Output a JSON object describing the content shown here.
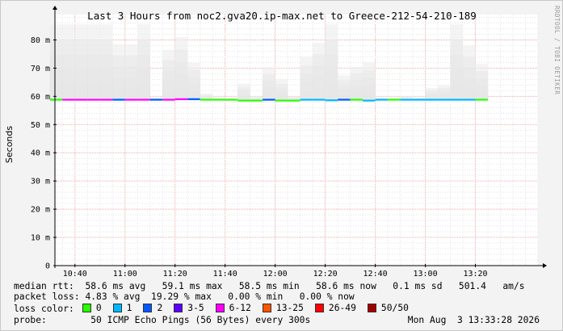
{
  "chart_data": {
    "type": "line",
    "title": "Last 3 Hours from noc2.gva20.ip-max.net to Greece-212-54-210-189",
    "ylabel": "Seconds",
    "watermark": "RRDTOOL / TOBI OETIKER",
    "ylim": [
      0,
      0.089
    ],
    "y_ticks": [
      {
        "value": 0,
        "label": "0"
      },
      {
        "value": 0.01,
        "label": "10 m"
      },
      {
        "value": 0.02,
        "label": "20 m"
      },
      {
        "value": 0.03,
        "label": "30 m"
      },
      {
        "value": 0.04,
        "label": "40 m"
      },
      {
        "value": 0.05,
        "label": "50 m"
      },
      {
        "value": 0.06,
        "label": "60 m"
      },
      {
        "value": 0.07,
        "label": "70 m"
      },
      {
        "value": 0.08,
        "label": "80 m"
      }
    ],
    "x_ticks": [
      "10:40",
      "11:00",
      "11:20",
      "11:40",
      "12:00",
      "12:20",
      "12:40",
      "13:00",
      "13:20"
    ],
    "x_tick_minutes": [
      640,
      660,
      680,
      700,
      720,
      740,
      760,
      780,
      800
    ],
    "x_range_minutes": [
      632,
      825
    ],
    "interval_minutes": 5,
    "samples": [
      {
        "t": 632.5,
        "median": 0.0588,
        "min": 0.0585,
        "max": 0.0855,
        "loss": 0
      },
      {
        "t": 637.5,
        "median": 0.0588,
        "min": 0.0585,
        "max": 0.0855,
        "loss": 6
      },
      {
        "t": 642.5,
        "median": 0.0588,
        "min": 0.0585,
        "max": 0.0855,
        "loss": 6
      },
      {
        "t": 647.5,
        "median": 0.0588,
        "min": 0.0585,
        "max": 0.0855,
        "loss": 6
      },
      {
        "t": 652.5,
        "median": 0.0588,
        "min": 0.0585,
        "max": 0.0855,
        "loss": 6
      },
      {
        "t": 657.5,
        "median": 0.0588,
        "min": 0.0585,
        "max": 0.0785,
        "loss": 2
      },
      {
        "t": 662.5,
        "median": 0.0588,
        "min": 0.0585,
        "max": 0.0785,
        "loss": 6
      },
      {
        "t": 667.5,
        "median": 0.0588,
        "min": 0.0585,
        "max": 0.0855,
        "loss": 6
      },
      {
        "t": 672.5,
        "median": 0.0588,
        "min": 0.0585,
        "max": 0.0595,
        "loss": 2
      },
      {
        "t": 677.5,
        "median": 0.0588,
        "min": 0.0585,
        "max": 0.0765,
        "loss": 6
      },
      {
        "t": 682.5,
        "median": 0.059,
        "min": 0.0585,
        "max": 0.081,
        "loss": 6
      },
      {
        "t": 687.5,
        "median": 0.059,
        "min": 0.0585,
        "max": 0.072,
        "loss": 2
      },
      {
        "t": 692.5,
        "median": 0.0588,
        "min": 0.0585,
        "max": 0.061,
        "loss": 0
      },
      {
        "t": 697.5,
        "median": 0.0588,
        "min": 0.0585,
        "max": 0.0595,
        "loss": 0
      },
      {
        "t": 702.5,
        "median": 0.0588,
        "min": 0.0585,
        "max": 0.059,
        "loss": 0
      },
      {
        "t": 707.5,
        "median": 0.0585,
        "min": 0.0583,
        "max": 0.0645,
        "loss": 0
      },
      {
        "t": 712.5,
        "median": 0.0585,
        "min": 0.0583,
        "max": 0.06,
        "loss": 0
      },
      {
        "t": 717.5,
        "median": 0.0588,
        "min": 0.0585,
        "max": 0.07,
        "loss": 2
      },
      {
        "t": 722.5,
        "median": 0.0585,
        "min": 0.0583,
        "max": 0.066,
        "loss": 0
      },
      {
        "t": 727.5,
        "median": 0.0585,
        "min": 0.0583,
        "max": 0.06,
        "loss": 0
      },
      {
        "t": 732.5,
        "median": 0.0588,
        "min": 0.0585,
        "max": 0.074,
        "loss": 1
      },
      {
        "t": 737.5,
        "median": 0.0588,
        "min": 0.0585,
        "max": 0.079,
        "loss": 1
      },
      {
        "t": 742.5,
        "median": 0.0586,
        "min": 0.0583,
        "max": 0.0855,
        "loss": 1
      },
      {
        "t": 747.5,
        "median": 0.0588,
        "min": 0.0585,
        "max": 0.0675,
        "loss": 2
      },
      {
        "t": 752.5,
        "median": 0.0588,
        "min": 0.0585,
        "max": 0.0705,
        "loss": 0
      },
      {
        "t": 757.5,
        "median": 0.0585,
        "min": 0.0583,
        "max": 0.072,
        "loss": 1
      },
      {
        "t": 762.5,
        "median": 0.0588,
        "min": 0.0585,
        "max": 0.0595,
        "loss": 1
      },
      {
        "t": 767.5,
        "median": 0.0588,
        "min": 0.0585,
        "max": 0.0595,
        "loss": 0
      },
      {
        "t": 772.5,
        "median": 0.0588,
        "min": 0.0585,
        "max": 0.06,
        "loss": 1
      },
      {
        "t": 777.5,
        "median": 0.0588,
        "min": 0.0585,
        "max": 0.0595,
        "loss": 1
      },
      {
        "t": 782.5,
        "median": 0.0588,
        "min": 0.0585,
        "max": 0.063,
        "loss": 1
      },
      {
        "t": 787.5,
        "median": 0.0588,
        "min": 0.0585,
        "max": 0.064,
        "loss": 1
      },
      {
        "t": 792.5,
        "median": 0.0588,
        "min": 0.0585,
        "max": 0.0855,
        "loss": 1
      },
      {
        "t": 797.5,
        "median": 0.0588,
        "min": 0.0585,
        "max": 0.078,
        "loss": 1
      },
      {
        "t": 802.5,
        "median": 0.0588,
        "min": 0.0585,
        "max": 0.0715,
        "loss": 0
      }
    ],
    "grid": true
  },
  "stats": {
    "median_label": "median rtt:",
    "median_values": "58.6 ms avg   59.1 ms max   58.5 ms min   58.6 ms now   0.1 ms sd   501.4   am/s",
    "loss_label": "packet loss:",
    "loss_values": "4.83 % avg  19.29 % max   0.00 % min   0.00 % now",
    "legend_label": "loss color:",
    "legend": [
      {
        "label": "0",
        "color": "#26ff00"
      },
      {
        "label": "1",
        "color": "#00b8ff"
      },
      {
        "label": "2",
        "color": "#0059ff"
      },
      {
        "label": "3-5",
        "color": "#5e00ff"
      },
      {
        "label": "6-12",
        "color": "#ff00ff"
      },
      {
        "label": "13-25",
        "color": "#ff5500"
      },
      {
        "label": "26-49",
        "color": "#ff0000"
      },
      {
        "label": "50/50",
        "color": "#a10000"
      }
    ],
    "probe_label": "probe:",
    "probe_values": "50 ICMP Echo Pings (56 Bytes) every 300s",
    "probe_date": "Mon Aug  3 13:33:28 2026"
  }
}
